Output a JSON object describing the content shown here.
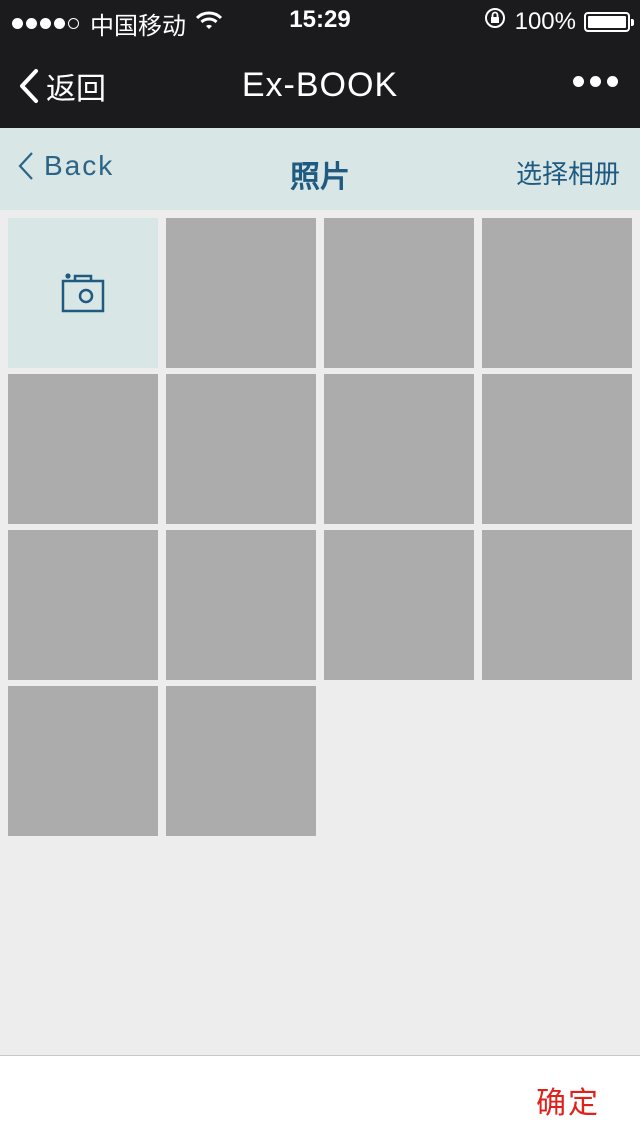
{
  "status_bar": {
    "carrier": "中国移动",
    "time": "15:29",
    "battery": "100%"
  },
  "nav": {
    "back_label": "返回",
    "title": "Ex-BOOK"
  },
  "subnav": {
    "back_label": "Back",
    "title": "照片",
    "album_label": "选择相册"
  },
  "grid": {
    "photo_count": 13
  },
  "footer": {
    "confirm_label": "确定"
  },
  "colors": {
    "accent_blue": "#1f5a80",
    "confirm_red": "#e0201a",
    "subbar_bg": "#d9e6e6",
    "photo_placeholder": "#acacac"
  }
}
